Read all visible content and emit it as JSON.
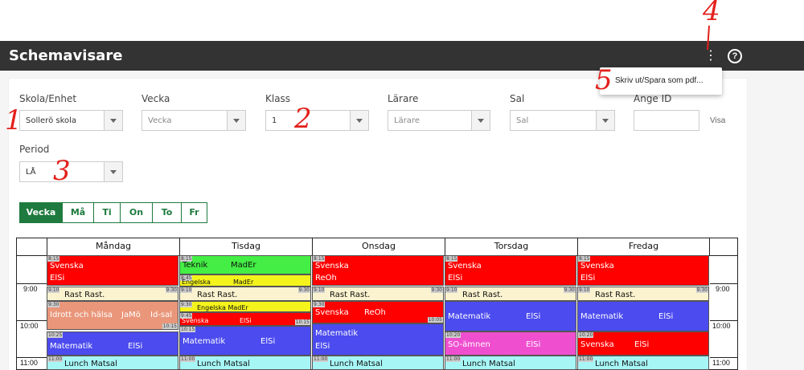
{
  "app": {
    "title": "Schemavisare",
    "menu_item": "Skriv ut/Spara som pdf..."
  },
  "filters": {
    "school_label": "Skola/Enhet",
    "school_value": "Sollerö skola",
    "week_label": "Vecka",
    "week_placeholder": "Vecka",
    "class_label": "Klass",
    "class_value": "1",
    "teacher_label": "Lärare",
    "teacher_placeholder": "Lärare",
    "room_label": "Sal",
    "room_placeholder": "Sal",
    "id_label": "Ange ID",
    "show_label": "Visa",
    "period_label": "Period",
    "period_value": "LÅ"
  },
  "day_tabs": [
    "Vecka",
    "Må",
    "Ti",
    "On",
    "To",
    "Fr"
  ],
  "days": [
    "Måndag",
    "Tisdag",
    "Onsdag",
    "Torsdag",
    "Fredag"
  ],
  "hours": [
    "9:00",
    "10:00",
    "11:00"
  ],
  "annotations": [
    "1",
    "2",
    "3",
    "4",
    "5"
  ],
  "colors": {
    "svenska": "#ff0000",
    "teknik": "#44ee44",
    "engelska": "#f4f41c",
    "rast": "#fbf3cf",
    "idrott": "#e9967a",
    "matematik": "#4b4bef",
    "so": "#ef4fcf",
    "lunch": "#a7f6f6",
    "accent": "#1e7a3e"
  },
  "lessons": {
    "mon": {
      "svenska": {
        "name": "Svenska",
        "teacher": "ElSi",
        "start": "8:15"
      },
      "rast": {
        "name": "Rast Rast.",
        "start": "9:10",
        "end": "9:30"
      },
      "idrott": {
        "name": "Idrott och hälsa",
        "teacher": "JaMö",
        "room": "Id-sal",
        "start": "9:30",
        "end": "10:15"
      },
      "matematik": {
        "name": "Matematik",
        "teacher": "ElSi",
        "start": "10:25"
      },
      "lunch": {
        "name": "Lunch Matsal",
        "start": "11:00"
      }
    },
    "tue": {
      "teknik": {
        "name": "Teknik",
        "teacher": "MadEr",
        "start": "8:15"
      },
      "engelska1": {
        "name": "Engelska",
        "teacher": "MadEr",
        "start": "8:45"
      },
      "rast": {
        "name": "Rast Rast.",
        "start": "9:10",
        "end": "9:30"
      },
      "engelska2": {
        "name": "Engelska MadEr",
        "start": "9:30"
      },
      "svenska": {
        "name": "Svenska",
        "teacher": "ElSi",
        "start": "9:45",
        "end": "10:15"
      },
      "matematik": {
        "name": "Matematik",
        "teacher": "ElSi",
        "start": "10:15"
      },
      "lunch": {
        "name": "Lunch Matsal",
        "start": "11:00"
      }
    },
    "wed": {
      "svenska": {
        "name": "Svenska",
        "teacher": "ReOh",
        "start": "8:15"
      },
      "rast": {
        "name": "Rast Rast.",
        "start": "9:10",
        "end": "9:30"
      },
      "svenska2": {
        "name": "Svenska",
        "teacher": "ReOh",
        "start": "9:30",
        "end": "10:05"
      },
      "matematik": {
        "name": "Matematik",
        "teacher": "ElSi",
        "start": "10:05"
      },
      "lunch": {
        "name": "Lunch Matsal",
        "start": "11:00"
      }
    },
    "thu": {
      "svenska": {
        "name": "Svenska",
        "teacher": "ElSi",
        "start": "8:15"
      },
      "rast": {
        "name": "Rast Rast.",
        "start": "9:10",
        "end": "9:30"
      },
      "matematik": {
        "name": "Matematik",
        "teacher": "ElSi",
        "start": "9:30",
        "end": "10:20"
      },
      "so": {
        "name": "SO-ämnen",
        "teacher": "ElSi",
        "start": "10:20"
      },
      "lunch": {
        "name": "Lunch Matsal",
        "start": "11:00"
      }
    },
    "fri": {
      "svenska": {
        "name": "Svenska",
        "teacher": "ElSi",
        "start": "8:15"
      },
      "rast": {
        "name": "Rast Rast.",
        "start": "9:10",
        "end": "9:30"
      },
      "matematik": {
        "name": "Matematik",
        "teacher": "ElSi",
        "start": "9:30",
        "end": "10:20"
      },
      "svenska2": {
        "name": "Svenska",
        "teacher": "ElSi",
        "start": "10:20"
      },
      "lunch": {
        "name": "Lunch Matsal",
        "start": "11:00"
      }
    }
  }
}
